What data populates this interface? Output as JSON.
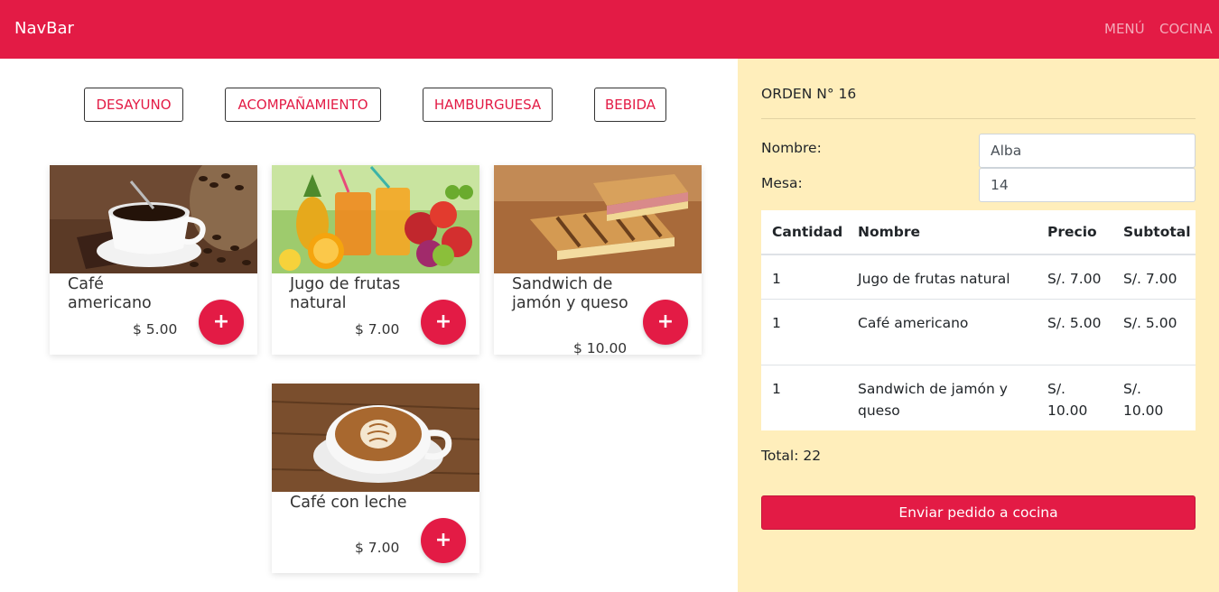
{
  "navbar": {
    "brand": "NavBar",
    "links": [
      "MENÚ",
      "COCINA"
    ]
  },
  "categories": [
    "DESAYUNO",
    "ACOMPAÑAMIENTO",
    "HAMBURGUESA",
    "BEBIDA"
  ],
  "products": [
    {
      "name": "Café americano",
      "price": "$ 5.00",
      "add_label": "+",
      "image": "coffee-cup-photo"
    },
    {
      "name": "Jugo de frutas natural",
      "price": "$ 7.00",
      "add_label": "+",
      "image": "fruit-juice-photo"
    },
    {
      "name": "Sandwich de jamón y queso",
      "price": "$ 10.00",
      "add_label": "+",
      "image": "ham-cheese-sandwich-photo"
    },
    {
      "name": "Café con leche",
      "price": "$ 7.00",
      "add_label": "+",
      "image": "latte-art-photo"
    }
  ],
  "order": {
    "title": "ORDEN N° 16",
    "name_label": "Nombre:",
    "name_value": "Alba",
    "table_label": "Mesa:",
    "table_value": "14",
    "columns": [
      "Cantidad",
      "Nombre",
      "Precio",
      "Subtotal"
    ],
    "rows": [
      {
        "qty": "1",
        "name": "Jugo de frutas natural",
        "price": "S/. 7.00",
        "subtotal": "S/. 7.00"
      },
      {
        "qty": "1",
        "name": "Café americano",
        "price": "S/. 5.00",
        "subtotal": "S/. 5.00"
      },
      {
        "qty": "1",
        "name": "Sandwich de jamón y queso",
        "price": "S/. 10.00",
        "subtotal": "S/. 10.00"
      }
    ],
    "total": "Total: 22",
    "send_label": "Enviar pedido a cocina"
  },
  "colors": {
    "accent": "#e31b45",
    "panel_bg": "#ffeebb"
  }
}
